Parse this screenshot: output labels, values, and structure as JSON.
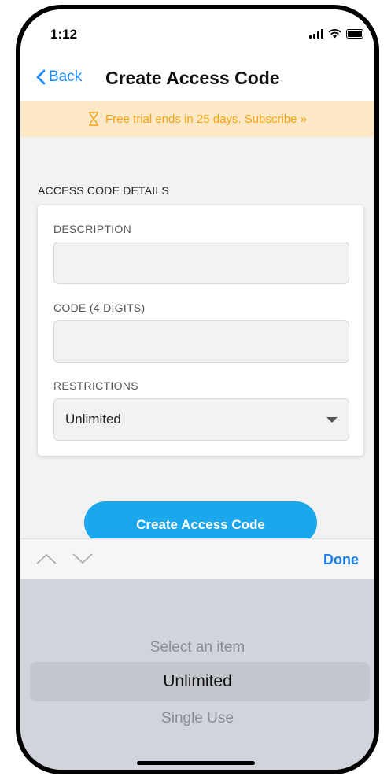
{
  "status_bar": {
    "time": "1:12"
  },
  "nav": {
    "back_label": "Back",
    "title": "Create Access Code"
  },
  "banner": {
    "text": "Free trial ends in 25 days. Subscribe »"
  },
  "section": {
    "label": "ACCESS CODE DETAILS"
  },
  "form": {
    "description_label": "DESCRIPTION",
    "description_value": "",
    "code_label": "CODE (4 DIGITS)",
    "code_value": "",
    "restrictions_label": "RESTRICTIONS",
    "restrictions_value": "Unlimited"
  },
  "actions": {
    "create_label": "Create Access Code"
  },
  "picker": {
    "done_label": "Done",
    "items": [
      "Select an item",
      "Unlimited",
      "Single Use"
    ],
    "selected": "Unlimited"
  },
  "colors": {
    "accent": "#1a8cff",
    "button": "#1aa7ec",
    "banner_bg": "#fde9c7",
    "banner_text": "#f3a312"
  },
  "icons": [
    "back-chevron-icon",
    "hourglass-icon",
    "dropdown-arrow-icon",
    "prev-arrow-icon",
    "next-arrow-icon",
    "signal-icon",
    "wifi-icon",
    "battery-icon"
  ]
}
